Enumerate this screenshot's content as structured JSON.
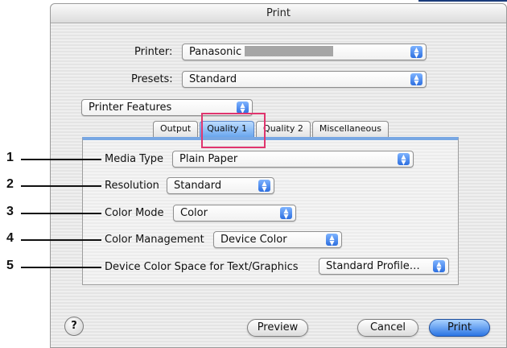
{
  "window": {
    "title": "Print"
  },
  "printer": {
    "label": "Printer:",
    "value": "Panasonic"
  },
  "presets": {
    "label": "Presets:",
    "value": "Standard"
  },
  "section": {
    "value": "Printer Features"
  },
  "tabs": [
    {
      "label": "Output"
    },
    {
      "label": "Quality 1"
    },
    {
      "label": "Quality 2"
    },
    {
      "label": "Miscellaneous"
    }
  ],
  "settings": [
    {
      "callout": "1",
      "label": "Media Type",
      "value": "Plain Paper"
    },
    {
      "callout": "2",
      "label": "Resolution",
      "value": "Standard"
    },
    {
      "callout": "3",
      "label": "Color Mode",
      "value": "Color"
    },
    {
      "callout": "4",
      "label": "Color Management",
      "value": "Device Color"
    },
    {
      "callout": "5",
      "label": "Device Color Space for Text/Graphics",
      "value": "Standard Profile…"
    }
  ],
  "buttons": {
    "help": "?",
    "preview": "Preview",
    "cancel": "Cancel",
    "print": "Print"
  },
  "icons": {
    "popup_arrows": "updown-arrows-icon",
    "help": "help-icon"
  },
  "colors": {
    "accent": "#2d6fe0",
    "highlight": "#e0356e"
  }
}
